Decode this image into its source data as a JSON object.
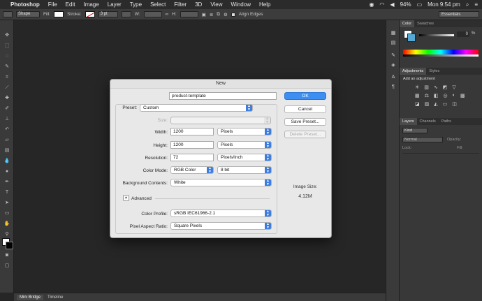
{
  "menubar": {
    "app_name": "Photoshop",
    "items": [
      "File",
      "Edit",
      "Image",
      "Layer",
      "Type",
      "Select",
      "Filter",
      "3D",
      "View",
      "Window",
      "Help"
    ],
    "battery": "94%",
    "clock": "Mon 9:54 pm"
  },
  "options_bar": {
    "mode": "Shape",
    "fill_label": "Fill:",
    "stroke_label": "Stroke:",
    "stroke_width": "3 pt",
    "w_label": "W:",
    "h_label": "H:",
    "align_edges": "Align Edges",
    "workspace": "Essentials"
  },
  "panels": {
    "color_tabs": [
      "Color",
      "Swatches"
    ],
    "color_value": "0",
    "color_pct": "%",
    "adjust_tabs": [
      "Adjustments",
      "Styles"
    ],
    "add_adjustment": "Add an adjustment",
    "layers_tabs": [
      "Layers",
      "Channels",
      "Paths"
    ],
    "kind": "Kind",
    "blend_mode": "Normal",
    "opacity_label": "Opacity:",
    "lock_label": "Lock:",
    "fill_label": "Fill:"
  },
  "bottom_tabs": [
    "Mini Bridge",
    "Timeline"
  ],
  "dialog": {
    "title": "New",
    "name_label": "Name:",
    "name_value": "product-template",
    "preset_label": "Preset:",
    "preset_value": "Custom",
    "size_label": "Size:",
    "width_label": "Width:",
    "width_value": "1200",
    "width_unit": "Pixels",
    "height_label": "Height:",
    "height_value": "1200",
    "height_unit": "Pixels",
    "resolution_label": "Resolution:",
    "resolution_value": "72",
    "resolution_unit": "Pixels/Inch",
    "color_mode_label": "Color Mode:",
    "color_mode_value": "RGB Color",
    "bit_depth": "8 bit",
    "bg_label": "Background Contents:",
    "bg_value": "White",
    "advanced_label": "Advanced",
    "profile_label": "Color Profile:",
    "profile_value": "sRGB IEC61966-2.1",
    "aspect_label": "Pixel Aspect Ratio:",
    "aspect_value": "Square Pixels",
    "ok": "OK",
    "cancel": "Cancel",
    "save_preset": "Save Preset...",
    "delete_preset": "Delete Preset...",
    "image_size_label": "Image Size:",
    "image_size_value": "4.12M"
  }
}
